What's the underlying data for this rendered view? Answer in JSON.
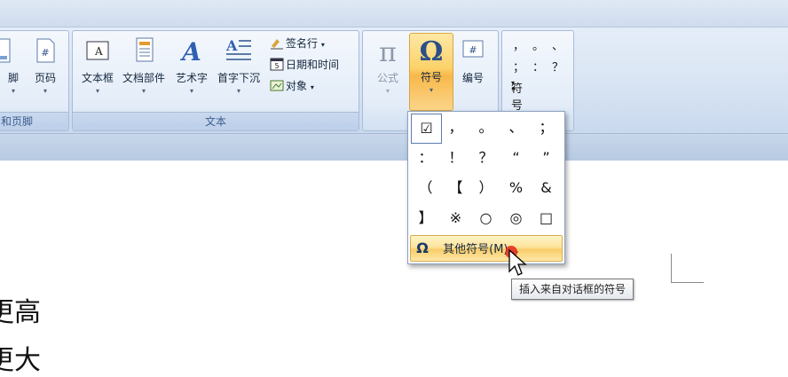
{
  "ribbon": {
    "header_footer_group": {
      "caption": "和页脚",
      "partial_button_label": "脚",
      "page_number_label": "页码"
    },
    "text_group": {
      "caption": "文本",
      "textbox_label": "文本框",
      "quickparts_label": "文档部件",
      "wordart_label": "艺术字",
      "dropcap_label": "首字下沉",
      "signature_label": "签名行",
      "datetime_label": "日期和时间",
      "object_label": "对象"
    },
    "symbols_group": {
      "equation_label": "公式",
      "symbol_label": "符号",
      "number_label": "编号"
    },
    "special_symbols_group": {
      "symbols": [
        "，",
        "。",
        "、",
        "；",
        "：",
        "？"
      ],
      "dropdown_label": "符号"
    }
  },
  "document": {
    "line1": "更高",
    "line2": "更大"
  },
  "symbol_dropdown": {
    "grid": [
      [
        "☑",
        "，",
        "。",
        "、",
        "；"
      ],
      [
        "：",
        "！",
        "？",
        "“",
        "”"
      ],
      [
        "（",
        "【",
        "）",
        "%",
        "&"
      ],
      [
        "】",
        "※",
        "○",
        "◎",
        "□"
      ]
    ],
    "more_symbols_label": "其他符号(M)..."
  },
  "tooltip": {
    "text": "插入来自对话框的符号"
  },
  "colors": {
    "ribbon_bg": "#dbe6f4",
    "highlight": "#fcd26a",
    "group_border": "#a8bcd8"
  }
}
